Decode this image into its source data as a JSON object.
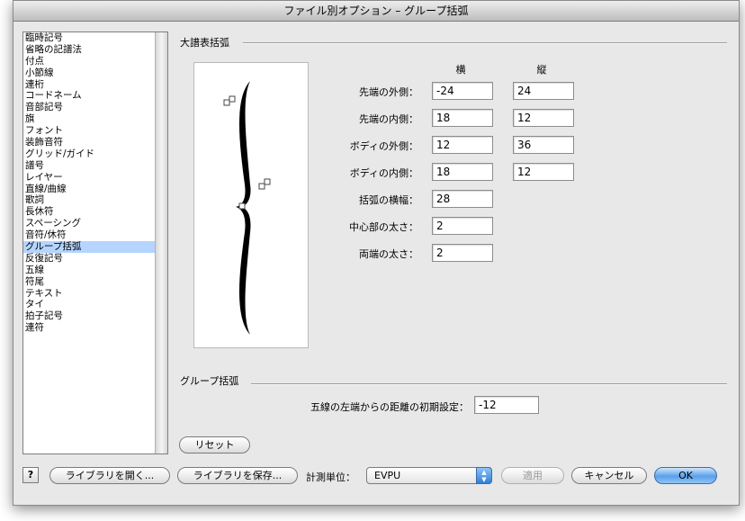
{
  "window": {
    "title": "ファイル別オプション – グループ括弧"
  },
  "sidebar": {
    "items": [
      "臨時記号",
      "省略の記譜法",
      "付点",
      "小節線",
      "連桁",
      "コードネーム",
      "音部記号",
      "旗",
      "フォント",
      "装飾音符",
      "グリッド/ガイド",
      "譜号",
      "レイヤー",
      "直線/曲線",
      "歌詞",
      "長休符",
      "スペーシング",
      "音符/休符",
      "グループ括弧",
      "反復記号",
      "五線",
      "符尾",
      "テキスト",
      "タイ",
      "拍子記号",
      "連符"
    ],
    "selected_index": 18
  },
  "bracket_section": {
    "title": "大譜表括弧",
    "col_headers": {
      "horizontal": "横",
      "vertical": "縦"
    },
    "rows": [
      {
        "label": "先端の外側：",
        "h": "-24",
        "v": "24"
      },
      {
        "label": "先端の内側：",
        "h": "18",
        "v": "12"
      },
      {
        "label": "ボディの外側：",
        "h": "12",
        "v": "36"
      },
      {
        "label": "ボディの内側：",
        "h": "18",
        "v": "12"
      },
      {
        "label": "括弧の横幅：",
        "h": "28"
      },
      {
        "label": "中心部の太さ：",
        "h": "2"
      },
      {
        "label": "両端の太さ：",
        "h": "2"
      }
    ]
  },
  "group_section": {
    "title": "グループ括弧",
    "distance_label": "五線の左端からの距離の初期設定：",
    "distance_value": "-12"
  },
  "buttons": {
    "reset": "リセット",
    "help": "?",
    "open_library": "ライブラリを開く...",
    "save_library": "ライブラリを保存...",
    "units_label": "計測単位：",
    "units_value": "EVPU",
    "apply": "適用",
    "cancel": "キャンセル",
    "ok": "OK"
  }
}
